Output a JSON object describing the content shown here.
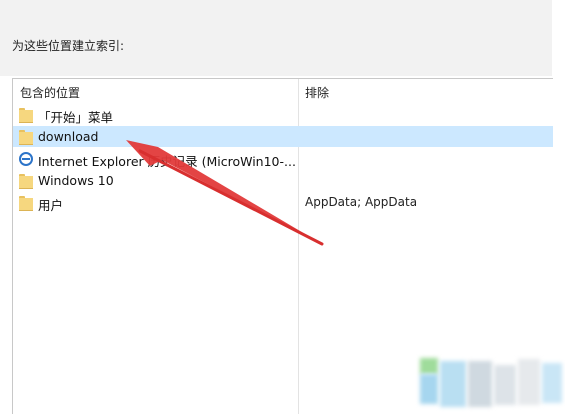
{
  "dialog": {
    "instruction": "为这些位置建立索引:"
  },
  "list": {
    "columns": {
      "location": "包含的位置",
      "exclude": "排除"
    },
    "rows": [
      {
        "icon": "folder-icon",
        "location": "「开始」菜单",
        "exclude": ""
      },
      {
        "icon": "folder-icon",
        "location": "download",
        "exclude": "",
        "selected": true
      },
      {
        "icon": "internet-explorer-icon",
        "location": "Internet Explorer 历史记录 (MicroWin10-...",
        "exclude": ""
      },
      {
        "icon": "folder-icon",
        "location": "Windows 10",
        "exclude": ""
      },
      {
        "icon": "folder-icon",
        "location": "用户",
        "exclude": "AppData; AppData"
      }
    ]
  },
  "colors": {
    "selection": "#cce8ff",
    "annotation_arrow": "#e23a3a",
    "folder": "#f6d77f",
    "ie_blue": "#2c74c9"
  }
}
